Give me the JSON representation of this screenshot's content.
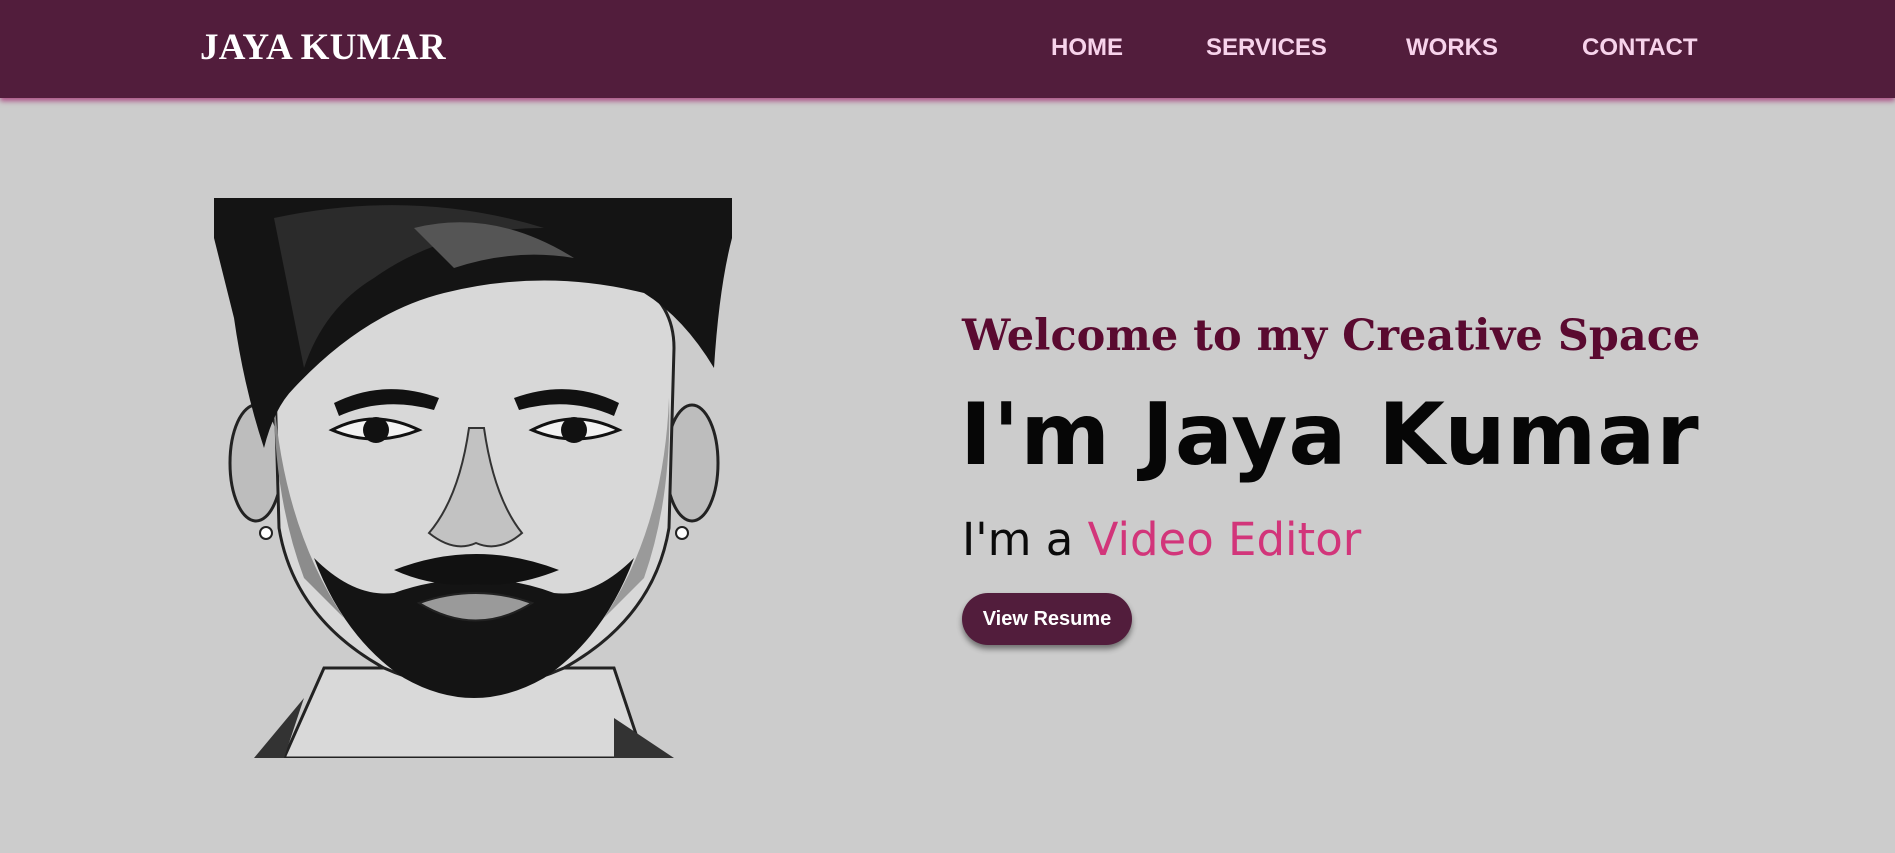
{
  "header": {
    "brand": "JAYA KUMAR",
    "nav": [
      {
        "label": "HOME"
      },
      {
        "label": "SERVICES"
      },
      {
        "label": "WORKS"
      },
      {
        "label": "CONTACT"
      }
    ]
  },
  "hero": {
    "welcome": "Welcome to my Creative Space",
    "name": "I'm Jaya Kumar",
    "role_prefix": "I'm a ",
    "role_title": "Video Editor",
    "resume_button": "View Resume"
  },
  "colors": {
    "navbar": "#521d3c",
    "background": "#cccccc",
    "accent": "#d2357a",
    "welcome": "#5a0a30"
  },
  "icons": {
    "portrait": "illustrated-portrait"
  }
}
